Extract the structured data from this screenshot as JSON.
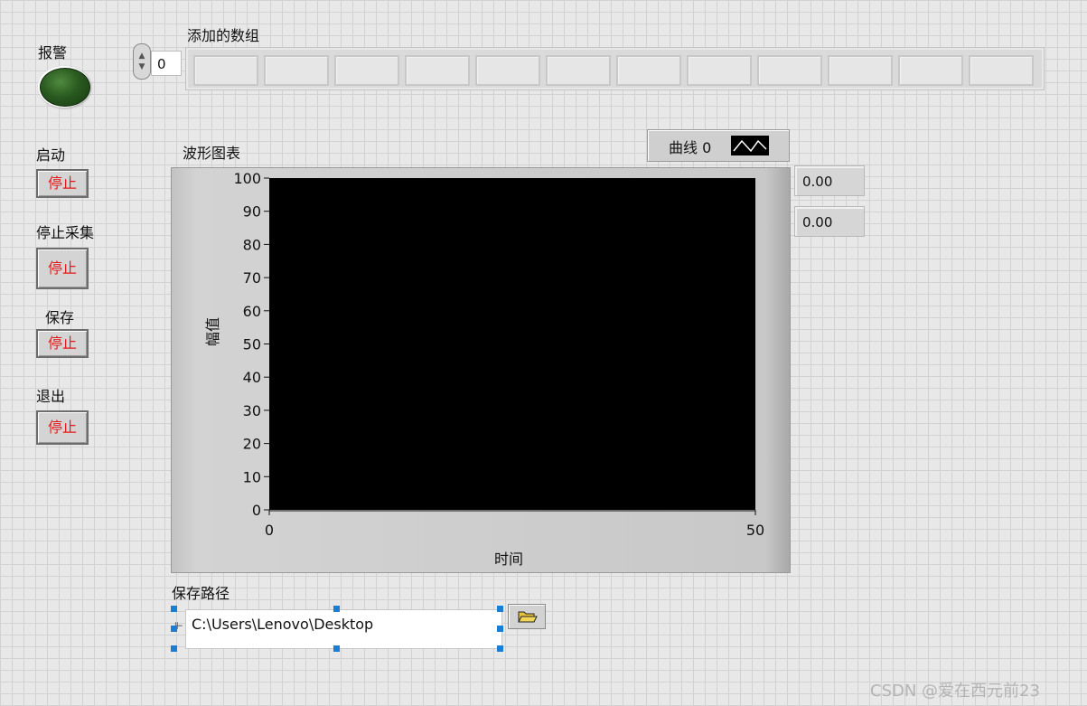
{
  "alarm": {
    "label": "报警",
    "led_color": "#2a5a20"
  },
  "buttons": [
    {
      "id": "start",
      "label": "启动",
      "button_text": "停止"
    },
    {
      "id": "stop-acquire",
      "label": "停止采集",
      "button_text": "停止"
    },
    {
      "id": "save",
      "label": "保存",
      "button_text": "停止"
    },
    {
      "id": "exit",
      "label": "退出",
      "button_text": "停止"
    }
  ],
  "array": {
    "label": "添加的数组",
    "index": "0",
    "cell_count": 12
  },
  "chart": {
    "label": "波形图表",
    "legend_label": "曲线 0"
  },
  "indicators": [
    "0.00",
    "0.00"
  ],
  "save_path": {
    "label": "保存路径",
    "value": "C:\\Users\\Lenovo\\Desktop"
  },
  "watermark": "CSDN @爱在西元前23",
  "chart_data": {
    "type": "line",
    "title": "",
    "xlabel": "时间",
    "ylabel": "幅值",
    "xlim": [
      0,
      50
    ],
    "ylim": [
      0,
      100
    ],
    "x_ticks": [
      "0",
      "50"
    ],
    "y_ticks": [
      "100",
      "90",
      "80",
      "70",
      "60",
      "50",
      "40",
      "30",
      "20",
      "10",
      "0"
    ],
    "plot_background": "#000000",
    "series": []
  }
}
